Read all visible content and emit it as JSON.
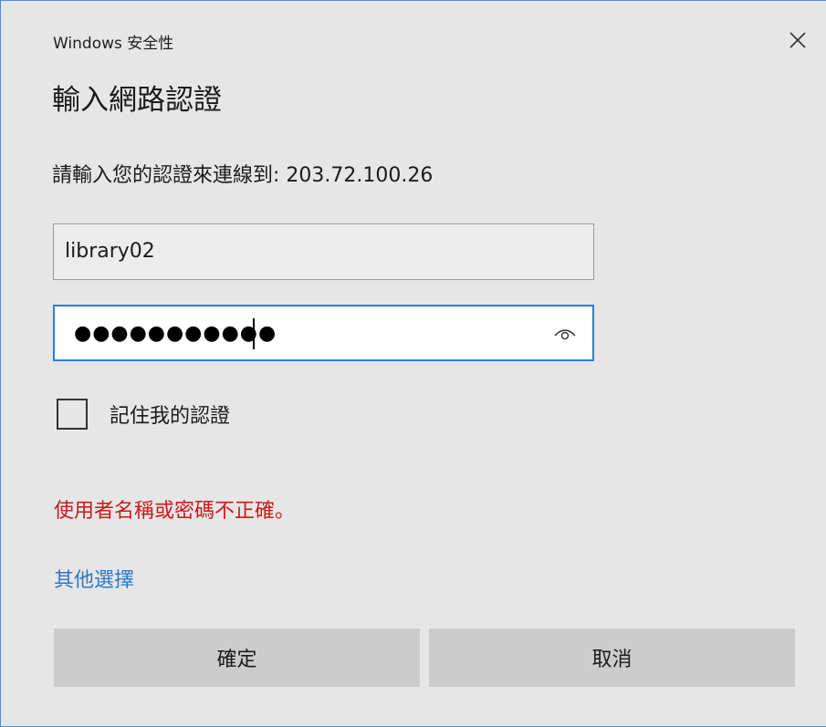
{
  "window": {
    "caption": "Windows 安全性",
    "close_icon": "close-icon"
  },
  "dialog": {
    "heading": "輸入網路認證",
    "prompt": "請輸入您的認證來連線到: 203.72.100.26",
    "username_value": "library02",
    "password_mask": "●●●●●●●●●●●",
    "password_length": 11,
    "reveal_icon": "eye-icon",
    "remember_label": "記住我的認證",
    "remember_checked": false,
    "error_message": "使用者名稱或密碼不正確。",
    "more_choices": "其他選擇",
    "ok_label": "確定",
    "cancel_label": "取消"
  },
  "colors": {
    "background": "#e6e6e6",
    "accent": "#2a7fd6",
    "error": "#c91a1a",
    "link": "#2b79c9",
    "button": "#cccccc"
  }
}
